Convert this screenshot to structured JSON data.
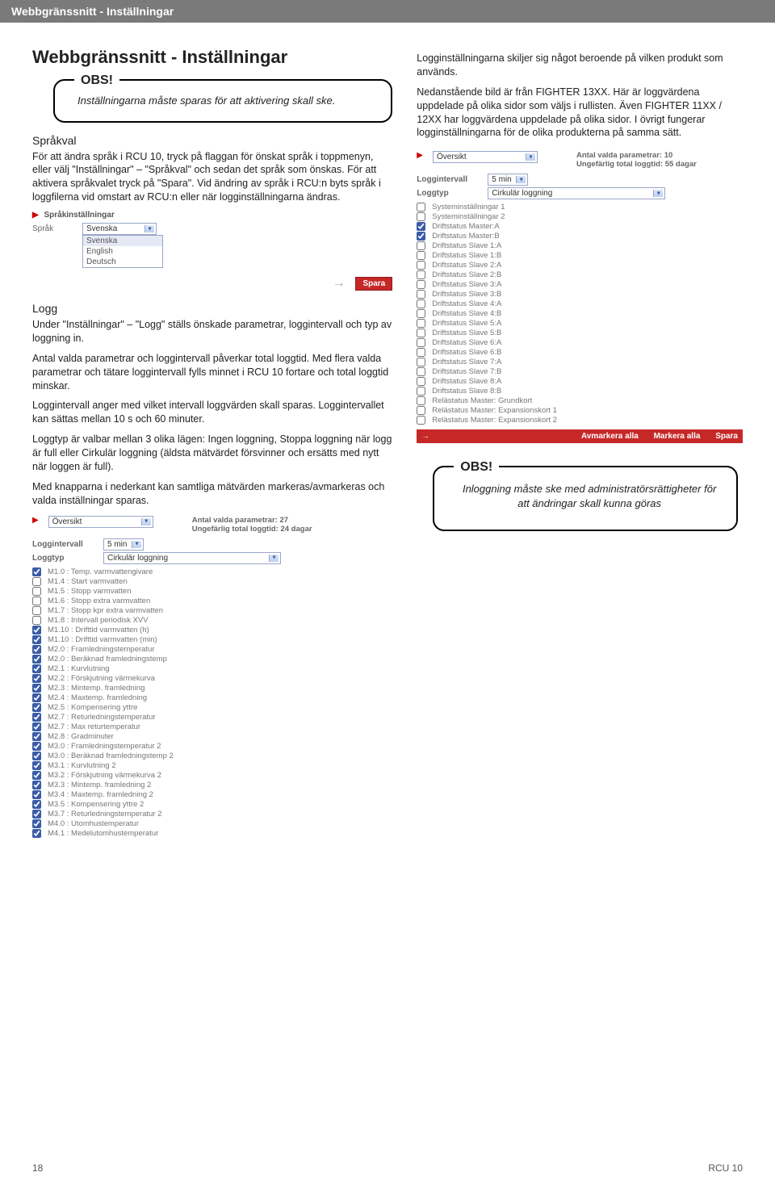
{
  "header": {
    "title": "Webbgränssnitt - Inställningar"
  },
  "left": {
    "title": "Webbgränssnitt - Inställningar",
    "obs": {
      "label": "OBS!",
      "text": "Inställningarna måste sparas för att aktivering skall ske."
    },
    "sprakval_h": "Språkval",
    "sprakval_p": "För att ändra språk i RCU 10, tryck på flaggan för önskat språk i toppmenyn, eller välj \"Inställningar\" – \"Språkval\" och sedan det språk som önskas. För att aktivera språkvalet tryck på \"Spara\". Vid ändring av språk i RCU:n byts språk i loggfilerna vid omstart av RCU:n eller när logginställningarna ändras.",
    "sprak_widget": {
      "header": "Språkinställningar",
      "label": "Språk",
      "selected": "Svenska",
      "options": [
        "Svenska",
        "English",
        "Deutsch"
      ],
      "save": "Spara"
    },
    "logg_h": "Logg",
    "logg_p1": "Under \"Inställningar\" – \"Logg\" ställs önskade parametrar, loggintervall och typ av loggning in.",
    "logg_p2": "Antal valda parametrar och loggintervall påverkar total loggtid. Med flera valda parametrar och tätare loggintervall fylls minnet i RCU 10 fortare och total loggtid minskar.",
    "logg_p3": "Loggintervall anger med vilket intervall loggvärden skall sparas. Loggintervallet kan sättas mellan 10 s och 60 minuter.",
    "logg_p4": "Loggtyp är valbar mellan 3 olika lägen: Ingen loggning, Stoppa loggning när logg är full eller Cirkulär loggning (äldsta mätvärdet försvinner och ersätts med nytt när loggen är full).",
    "logg_p5": "Med knapparna i nederkant kan samtliga mätvärden markeras/avmarkeras och valda inställningar sparas.",
    "logg_widget": {
      "oversikt": "Översikt",
      "meta1": "Antal valda parametrar: 27",
      "meta2": "Ungefärlig total loggtid: 24 dagar",
      "interval_lbl": "Loggintervall",
      "interval_val": "5 min",
      "type_lbl": "Loggtyp",
      "type_val": "Cirkulär loggning",
      "items": [
        {
          "c": true,
          "t": "M1.0 : Temp. varmvattengivare"
        },
        {
          "c": false,
          "t": "M1.4 : Start varmvatten"
        },
        {
          "c": false,
          "t": "M1.5 : Stopp varmvatten"
        },
        {
          "c": false,
          "t": "M1.6 : Stopp extra varmvatten"
        },
        {
          "c": false,
          "t": "M1.7 : Stopp kpr extra varmvatten"
        },
        {
          "c": false,
          "t": "M1.8 : Intervall periodisk XVV"
        },
        {
          "c": true,
          "t": "M1.10 : Drifttid varmvatten (h)"
        },
        {
          "c": true,
          "t": "M1.10 : Drifttid varmvatten (min)"
        },
        {
          "c": true,
          "t": "M2.0 : Framledningstemperatur"
        },
        {
          "c": true,
          "t": "M2.0 : Beräknad framledningstemp"
        },
        {
          "c": true,
          "t": "M2.1 : Kurvlutning"
        },
        {
          "c": true,
          "t": "M2.2 : Förskjutning värmekurva"
        },
        {
          "c": true,
          "t": "M2.3 : Mintemp. framledning"
        },
        {
          "c": true,
          "t": "M2.4 : Maxtemp. framledning"
        },
        {
          "c": true,
          "t": "M2.5 : Kompensering yttre"
        },
        {
          "c": true,
          "t": "M2.7 : Returledningstemperatur"
        },
        {
          "c": true,
          "t": "M2.7 : Max returtemperatur"
        },
        {
          "c": true,
          "t": "M2.8 : Gradminuter"
        },
        {
          "c": true,
          "t": "M3.0 : Framledningstemperatur 2"
        },
        {
          "c": true,
          "t": "M3.0 : Beräknad framledningstemp 2"
        },
        {
          "c": true,
          "t": "M3.1 : Kurvlutning 2"
        },
        {
          "c": true,
          "t": "M3.2 : Förskjutning värmekurva 2"
        },
        {
          "c": true,
          "t": "M3.3 : Mintemp. framledning 2"
        },
        {
          "c": true,
          "t": "M3.4 : Maxtemp. framledning 2"
        },
        {
          "c": true,
          "t": "M3.5 : Kompensering yttre 2"
        },
        {
          "c": true,
          "t": "M3.7 : Returledningstemperatur 2"
        },
        {
          "c": true,
          "t": "M4.0 : Utomhustemperatur"
        },
        {
          "c": true,
          "t": "M4.1 : Medelutomhustemperatur"
        }
      ]
    }
  },
  "right": {
    "p1": "Logginställningarna skiljer sig något beroende på vilken produkt som används.",
    "p2": "Nedanstående bild är från FIGHTER 13XX. Här är loggvärdena uppdelade på olika sidor som väljs i rullisten. Även FIGHTER 11XX / 12XX har loggvärdena uppdelade på olika sidor. I övrigt fungerar logginställningarna för de olika produkterna på samma sätt.",
    "widget": {
      "oversikt": "Översikt",
      "meta1": "Antal valda parametrar: 10",
      "meta2": "Ungefärlig total loggtid: 55 dagar",
      "interval_lbl": "Loggintervall",
      "interval_val": "5 min",
      "type_lbl": "Loggtyp",
      "type_val": "Cirkulär loggning",
      "items": [
        {
          "c": false,
          "t": "Systeminställningar 1"
        },
        {
          "c": false,
          "t": "Systeminställningar 2"
        },
        {
          "c": true,
          "t": "Driftstatus Master:A"
        },
        {
          "c": true,
          "t": "Driftstatus Master:B"
        },
        {
          "c": false,
          "t": "Driftstatus Slave 1:A"
        },
        {
          "c": false,
          "t": "Driftstatus Slave 1:B"
        },
        {
          "c": false,
          "t": "Driftstatus Slave 2:A"
        },
        {
          "c": false,
          "t": "Driftstatus Slave 2:B"
        },
        {
          "c": false,
          "t": "Driftstatus Slave 3:A"
        },
        {
          "c": false,
          "t": "Driftstatus Slave 3:B"
        },
        {
          "c": false,
          "t": "Driftstatus Slave 4:A"
        },
        {
          "c": false,
          "t": "Driftstatus Slave 4:B"
        },
        {
          "c": false,
          "t": "Driftstatus Slave 5:A"
        },
        {
          "c": false,
          "t": "Driftstatus Slave 5:B"
        },
        {
          "c": false,
          "t": "Driftstatus Slave 6:A"
        },
        {
          "c": false,
          "t": "Driftstatus Slave 6:B"
        },
        {
          "c": false,
          "t": "Driftstatus Slave 7:A"
        },
        {
          "c": false,
          "t": "Driftstatus Slave 7:B"
        },
        {
          "c": false,
          "t": "Driftstatus Slave 8:A"
        },
        {
          "c": false,
          "t": "Driftstatus Slave 8:B"
        },
        {
          "c": false,
          "t": "Relästatus Master: Grundkort"
        },
        {
          "c": false,
          "t": "Relästatus Master: Expansionskort 1"
        },
        {
          "c": false,
          "t": "Relästatus Master: Expansionskort 2"
        }
      ],
      "buttons": [
        "Avmarkera alla",
        "Markera alla",
        "Spara"
      ]
    },
    "obs": {
      "label": "OBS!",
      "text": "Inloggning måste ske med administratörsrättigheter för att ändringar skall kunna göras"
    }
  },
  "footer": {
    "page": "18",
    "product": "RCU 10"
  }
}
